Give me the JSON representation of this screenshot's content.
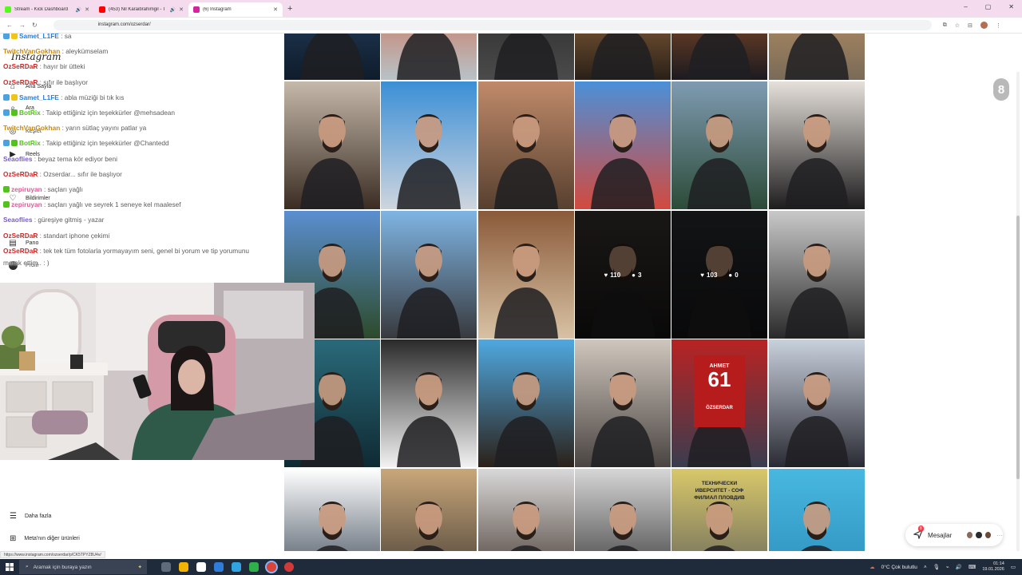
{
  "browser": {
    "tabs": [
      {
        "title": "Stream - Kick Dashboard",
        "favicon_color": "#53fc18",
        "active": false,
        "speaker": true
      },
      {
        "title": "(453) Nil Karaibrahimgil - T",
        "favicon_color": "#ff0000",
        "active": false,
        "speaker": true
      },
      {
        "title": "(6) Instagram",
        "favicon_color": "#d6249f",
        "active": true,
        "speaker": false
      }
    ],
    "new_tab": "+",
    "url": "instagram.com/ozserdar/",
    "window_controls": [
      "–",
      "▢",
      "✕"
    ]
  },
  "sidebar": {
    "logo": "Instagram",
    "items": [
      {
        "label": "Ana Sayfa",
        "icon": "home-icon",
        "glyph": "⌂"
      },
      {
        "label": "Ara",
        "icon": "search-icon",
        "glyph": "⌕"
      },
      {
        "label": "Keşfet",
        "icon": "explore-icon",
        "glyph": "◎"
      },
      {
        "label": "Reels",
        "icon": "reels-icon",
        "glyph": "▶"
      },
      {
        "label": "Bildirimler",
        "icon": "heart-icon",
        "glyph": "♡"
      },
      {
        "label": "Pano",
        "icon": "dashboard-icon",
        "glyph": "▤"
      },
      {
        "label": "Profil",
        "icon": "profile-icon",
        "glyph": ""
      }
    ],
    "more": {
      "label": "Daha fazla",
      "glyph": "☰"
    },
    "meta": {
      "label": "Meta'nın diğer ürünleri",
      "glyph": "⊞"
    }
  },
  "chat": [
    {
      "user": "Samet_L1FE",
      "text": ": sa",
      "color": "#2a7de1",
      "badges": [
        "#4aa3df",
        "#f0c419"
      ]
    },
    {
      "user": "TwitchVanGokhan",
      "text": ": aleykümselam",
      "color": "#c98a14",
      "badges": []
    },
    {
      "user": "OzSeRDaR",
      "text": ": hayır bir ütteki",
      "color": "#d62424",
      "badges": []
    },
    {
      "user": "OzSeRDaR",
      "text": ": sıfır ile başlıyor",
      "color": "#d62424",
      "badges": []
    },
    {
      "user": "Samet_L1FE",
      "text": ": abla müziği bi tık kıs",
      "color": "#2a7de1",
      "badges": [
        "#4aa3df",
        "#f0c419"
      ]
    },
    {
      "user": "BotRix",
      "text": ": Takip ettiğiniz için teşekkürler @mehsadean",
      "color": "#53c21b",
      "badges": [
        "#4aa3df",
        "#53c21b"
      ]
    },
    {
      "user": "TwitchVanGokhan",
      "text": ": yarın sütlaç yayını patlar ya",
      "color": "#c98a14",
      "badges": []
    },
    {
      "user": "BotRix",
      "text": ": Takip ettiğiniz için teşekkürler @Chantedd",
      "color": "#53c21b",
      "badges": [
        "#4aa3df",
        "#53c21b"
      ]
    },
    {
      "user": "Seaoflies",
      "text": ": beyaz tema kör ediyor beni",
      "color": "#7a5cc7",
      "badges": []
    },
    {
      "user": "OzSeRDaR",
      "text": ": Ozserdar... sıfır ile başlıyor",
      "color": "#d62424",
      "badges": []
    },
    {
      "user": "zepiruyan",
      "text": ": saçları yağlı",
      "color": "#e05a9a",
      "badges": [
        "#53c21b"
      ]
    },
    {
      "user": "zepiruyan",
      "text": ": saçları yağlı ve seyrek 1 seneye kel maalesef",
      "color": "#e05a9a",
      "badges": [
        "#53c21b"
      ]
    },
    {
      "user": "Seaoflies",
      "text": ": güreşiye gitmiş - yazar",
      "color": "#7a5cc7",
      "badges": []
    },
    {
      "user": "OzSeRDaR",
      "text": ": standart iphone çekimi",
      "color": "#d62424",
      "badges": []
    },
    {
      "user": "OzSeRDaR",
      "text": ": tek tek tüm fotolarla yormayayım seni, genel bi yorum ve tip yorumunu",
      "color": "#d62424",
      "badges": []
    }
  ],
  "chat_continuation": "merak ettim.. : )",
  "grid": {
    "hover_stats": [
      {
        "likes": "110",
        "comments": "3"
      },
      {
        "likes": "103",
        "comments": "0"
      }
    ],
    "rows": [
      [
        {
          "a": "#2d4f73",
          "b": "#0f1c2c"
        },
        {
          "a": "#d84b1d",
          "b": "#b8c2c8"
        },
        {
          "a": "#1b1b1b",
          "b": "#4b4b4b"
        },
        {
          "a": "#c98a4f",
          "b": "#2a2018"
        },
        {
          "a": "#c56a2a",
          "b": "#1d1a20"
        },
        {
          "a": "#d9a86a",
          "b": "#7a6a58"
        }
      ],
      [
        {
          "a": "#c5b9ab",
          "b": "#3a2c22"
        },
        {
          "a": "#3b8fd6",
          "b": "#cfd5de"
        },
        {
          "a": "#c08a6a",
          "b": "#57402f"
        },
        {
          "a": "#4b90d9",
          "b": "#d24a3f"
        },
        {
          "a": "#7f9bb2",
          "b": "#2c4b38"
        },
        {
          "a": "#e5e0da",
          "b": "#1e1d1e"
        }
      ],
      [
        {
          "a": "#5b8fd1",
          "b": "#2c4a2a"
        },
        {
          "a": "#7fb5e3",
          "b": "#38393d"
        },
        {
          "a": "#8a5a3a",
          "b": "#d8c2a4"
        },
        {
          "a": "#3a3532",
          "b": "#161514"
        },
        {
          "a": "#2b2d31",
          "b": "#141517"
        },
        {
          "a": "#c9c9c9",
          "b": "#2a2a2a"
        }
      ],
      [
        {
          "a": "#2a6a7a",
          "b": "#0f2a33"
        },
        {
          "a": "#2a2a2a",
          "b": "#f2f2f2"
        },
        {
          "a": "#4fa8e0",
          "b": "#2b2119"
        },
        {
          "a": "#cfc7bd",
          "b": "#4a4442"
        },
        {
          "a": "#b92323",
          "b": "#3a3d4f"
        },
        {
          "a": "#c9d1dd",
          "b": "#2a2a33"
        }
      ],
      [
        {
          "a": "#ffffff",
          "b": "#2d3a4a"
        },
        {
          "a": "#c9a77a",
          "b": "#3b3430"
        },
        {
          "a": "#d8d8d8",
          "b": "#3a2a22"
        },
        {
          "a": "#d6d6d6",
          "b": "#2a2a2a"
        },
        {
          "a": "#d8c86a",
          "b": "#5a5a5a"
        },
        {
          "a": "#48b8e0",
          "b": "#2a8ab8"
        }
      ]
    ],
    "jersey": {
      "name": "AHMET",
      "number": "61",
      "surname": "ÖZSERDAR"
    },
    "sign": {
      "line1": "ТЕХНИЧЕСКИ",
      "line2": "ИВЕРСИТЕТ - СОФ",
      "line3": "ФИЛИАЛ ПЛОВДИВ"
    }
  },
  "page_badge": "8",
  "messages_pill": {
    "label": "Mesajlar",
    "count": "8"
  },
  "status_url": "https://www.instagram.com/ozserdar/p/CK5TPYZ8U4v/",
  "taskbar": {
    "search_placeholder": "Aramak için buraya yazın",
    "weather": "0°C  Çok bulutlu",
    "time": "01:14",
    "date": "19.01.2026",
    "apps": [
      "#5f6a7a",
      "#f2b400",
      "#ffffff",
      "#2f7dd8",
      "#2fa4e0",
      "#30b04a",
      "#db4437",
      "#d23a3a"
    ]
  }
}
